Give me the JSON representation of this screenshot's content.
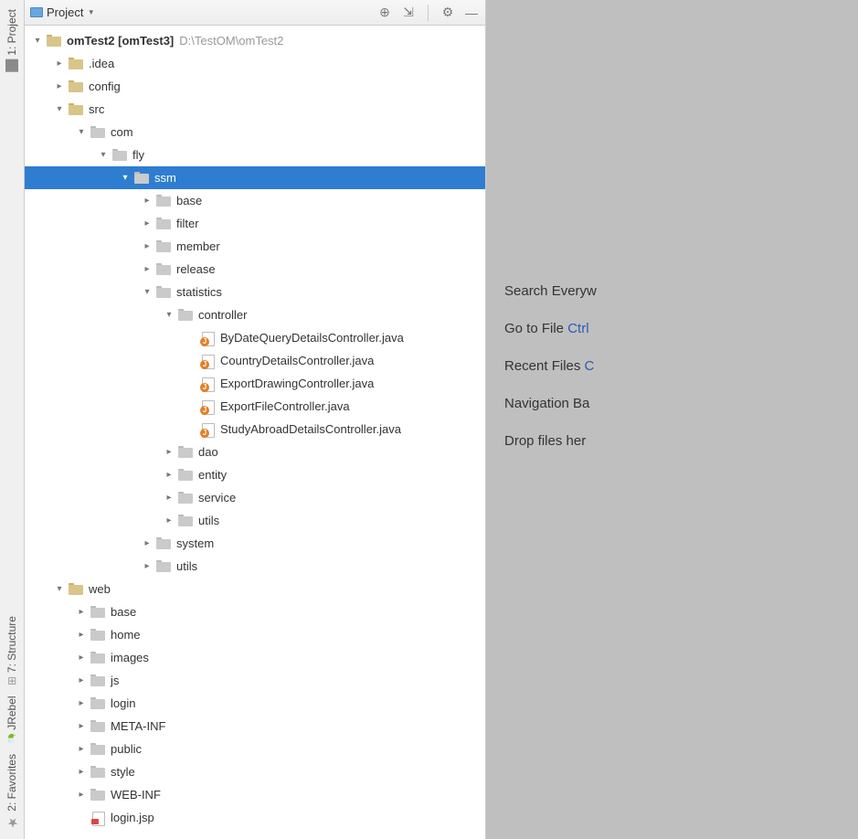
{
  "gutter": {
    "project": "1: Project",
    "structure": "7: Structure",
    "jrebel": "JRebel",
    "favorites": "2: Favorites"
  },
  "panel": {
    "title": "Project",
    "toolbar_icons": [
      "target",
      "collapse",
      "settings",
      "minimize"
    ]
  },
  "root": {
    "name": "omTest2",
    "bracket": "[omTest3]",
    "path": "D:\\TestOM\\omTest2"
  },
  "hints": [
    {
      "text": "Search Everyw"
    },
    {
      "text": "Go to File ",
      "shortcut": "Ctrl"
    },
    {
      "text": "Recent Files ",
      "shortcut": "C"
    },
    {
      "text": "Navigation Ba"
    },
    {
      "text": "Drop files her"
    }
  ],
  "tree": [
    {
      "depth": 0,
      "arrow": "down",
      "icon": "folder",
      "type": "root"
    },
    {
      "depth": 1,
      "arrow": "right",
      "icon": "folder",
      "label": ".idea"
    },
    {
      "depth": 1,
      "arrow": "right",
      "icon": "folder",
      "label": "config"
    },
    {
      "depth": 1,
      "arrow": "down",
      "icon": "folder",
      "label": "src"
    },
    {
      "depth": 2,
      "arrow": "down",
      "icon": "folder-gray",
      "label": "com"
    },
    {
      "depth": 3,
      "arrow": "down",
      "icon": "folder-gray",
      "label": "fly"
    },
    {
      "depth": 4,
      "arrow": "down",
      "icon": "folder-gray",
      "label": "ssm",
      "selected": true
    },
    {
      "depth": 5,
      "arrow": "right",
      "icon": "folder-gray",
      "label": "base"
    },
    {
      "depth": 5,
      "arrow": "right",
      "icon": "folder-gray",
      "label": "filter"
    },
    {
      "depth": 5,
      "arrow": "right",
      "icon": "folder-gray",
      "label": "member"
    },
    {
      "depth": 5,
      "arrow": "right",
      "icon": "folder-gray",
      "label": "release"
    },
    {
      "depth": 5,
      "arrow": "down",
      "icon": "folder-gray",
      "label": "statistics"
    },
    {
      "depth": 6,
      "arrow": "down",
      "icon": "folder-gray",
      "label": "controller"
    },
    {
      "depth": 7,
      "arrow": "blank",
      "icon": "java",
      "label": "ByDateQueryDetailsController.java"
    },
    {
      "depth": 7,
      "arrow": "blank",
      "icon": "java",
      "label": "CountryDetailsController.java"
    },
    {
      "depth": 7,
      "arrow": "blank",
      "icon": "java",
      "label": "ExportDrawingController.java"
    },
    {
      "depth": 7,
      "arrow": "blank",
      "icon": "java",
      "label": "ExportFileController.java"
    },
    {
      "depth": 7,
      "arrow": "blank",
      "icon": "java",
      "label": "StudyAbroadDetailsController.java"
    },
    {
      "depth": 6,
      "arrow": "right",
      "icon": "folder-gray",
      "label": "dao"
    },
    {
      "depth": 6,
      "arrow": "right",
      "icon": "folder-gray",
      "label": "entity"
    },
    {
      "depth": 6,
      "arrow": "right",
      "icon": "folder-gray",
      "label": "service"
    },
    {
      "depth": 6,
      "arrow": "right",
      "icon": "folder-gray",
      "label": "utils"
    },
    {
      "depth": 5,
      "arrow": "right",
      "icon": "folder-gray",
      "label": "system"
    },
    {
      "depth": 5,
      "arrow": "right",
      "icon": "folder-gray",
      "label": "utils"
    },
    {
      "depth": 1,
      "arrow": "down",
      "icon": "folder",
      "label": "web"
    },
    {
      "depth": 2,
      "arrow": "right",
      "icon": "folder-gray",
      "label": "base"
    },
    {
      "depth": 2,
      "arrow": "right",
      "icon": "folder-gray",
      "label": "home"
    },
    {
      "depth": 2,
      "arrow": "right",
      "icon": "folder-gray",
      "label": "images"
    },
    {
      "depth": 2,
      "arrow": "right",
      "icon": "folder-gray",
      "label": "js"
    },
    {
      "depth": 2,
      "arrow": "right",
      "icon": "folder-gray",
      "label": "login"
    },
    {
      "depth": 2,
      "arrow": "right",
      "icon": "folder-gray",
      "label": "META-INF"
    },
    {
      "depth": 2,
      "arrow": "right",
      "icon": "folder-gray",
      "label": "public"
    },
    {
      "depth": 2,
      "arrow": "right",
      "icon": "folder-gray",
      "label": "style"
    },
    {
      "depth": 2,
      "arrow": "right",
      "icon": "folder-gray",
      "label": "WEB-INF"
    },
    {
      "depth": 2,
      "arrow": "blank",
      "icon": "jsp",
      "label": "login.jsp"
    }
  ]
}
